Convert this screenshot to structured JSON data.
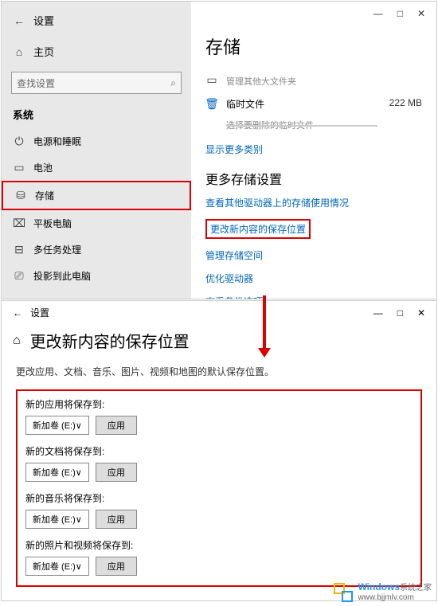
{
  "window1": {
    "titlebar": {
      "minimize": "—",
      "maximize": "□",
      "close": "✕"
    },
    "back": "←",
    "settings_label": "设置",
    "home_label": "主页",
    "search_placeholder": "查找设置",
    "section_label": "系统",
    "sidebar_items": [
      {
        "icon": "⏻",
        "label": "电源和睡眠"
      },
      {
        "icon": "▭",
        "label": "电池"
      },
      {
        "icon": "⛁",
        "label": "存储",
        "highlighted": true
      },
      {
        "icon": "⌧",
        "label": "平板电脑"
      },
      {
        "icon": "⊟",
        "label": "多任务处理"
      },
      {
        "icon": "⎚",
        "label": "投影到此电脑"
      }
    ],
    "main_title": "存储",
    "large_files": {
      "label": "管理其他大文件夹"
    },
    "temp_files": {
      "label": "临时文件",
      "sub": "选择要删除的临时文件",
      "value": "222 MB"
    },
    "show_more": "显示更多类别",
    "more_heading": "更多存储设置",
    "links": [
      {
        "label": "查看其他驱动器上的存储使用情况"
      },
      {
        "label": "更改新内容的保存位置",
        "highlighted": true
      },
      {
        "label": "管理存储空间"
      },
      {
        "label": "优化驱动器"
      },
      {
        "label": "查看备份选项"
      }
    ]
  },
  "window2": {
    "titlebar": {
      "back": "←",
      "settings_label": "设置",
      "minimize": "—",
      "maximize": "□",
      "close": "✕"
    },
    "home_icon": "⌂",
    "title": "更改新内容的保存位置",
    "description": "更改应用、文档、音乐、图片、视频和地图的默认保存位置。",
    "apply_label": "应用",
    "volume_label": "新加卷 (E:)",
    "items": [
      {
        "icon": "🖵",
        "label": "新的应用将保存到:"
      },
      {
        "icon": "🗎",
        "label": "新的文档将保存到:"
      },
      {
        "icon": "♪",
        "label": "新的音乐将保存到:"
      },
      {
        "icon": "🖼",
        "label": "新的照片和视频将保存到:"
      }
    ]
  },
  "watermark": {
    "brand": "Windows",
    "tagline": "系统之家",
    "url": "www.bjjmlv.com"
  }
}
